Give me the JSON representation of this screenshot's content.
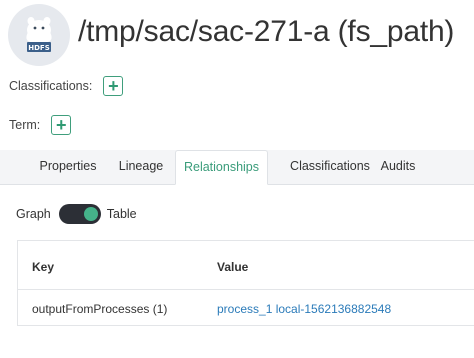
{
  "header": {
    "icon": "hdfs-icon",
    "icon_label": "HDFS",
    "title": "/tmp/sac/sac-271-a (fs_path)"
  },
  "meta": {
    "classifications_label": "Classifications:",
    "term_label": "Term:",
    "add_symbol": "+"
  },
  "tabs": [
    {
      "label": "Properties"
    },
    {
      "label": "Lineage"
    },
    {
      "label": "Relationships",
      "active": true
    },
    {
      "label": "Classifications"
    },
    {
      "label": "Audits"
    }
  ],
  "view_toggle": {
    "left_label": "Graph",
    "right_label": "Table",
    "selected": "Table"
  },
  "table": {
    "columns": [
      "Key",
      "Value"
    ],
    "rows": [
      {
        "key": "outputFromProcesses (1)",
        "value": "process_1 local-1562136882548"
      }
    ]
  },
  "colors": {
    "accent": "#3a9c7a",
    "link": "#2b7bb9",
    "tab_bar": "#f4f5f7"
  }
}
